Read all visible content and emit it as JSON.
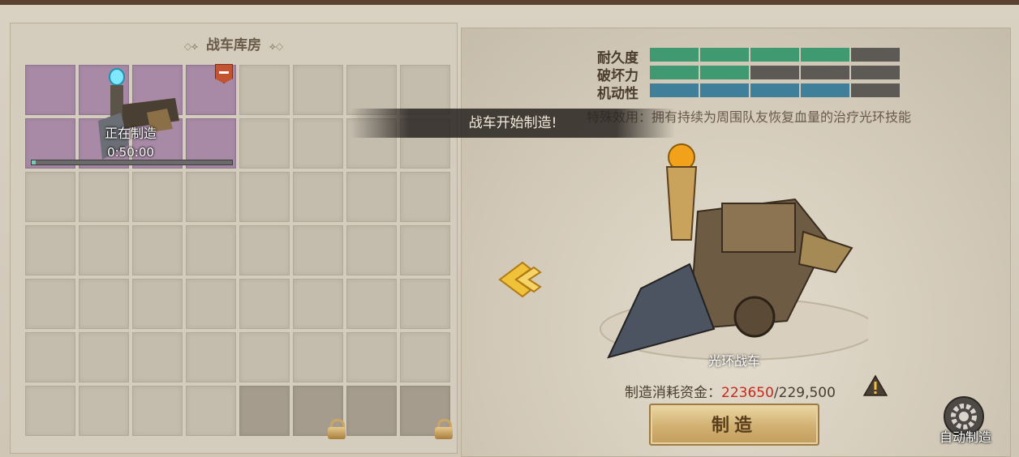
{
  "storage": {
    "title": "战车库房",
    "grid_rows": 7,
    "grid_cols": 8,
    "building": {
      "status": "正在制造",
      "time": "0:50:00",
      "progress": 0.02
    }
  },
  "details": {
    "stats": [
      {
        "label": "耐久度",
        "filled": 4,
        "total": 5,
        "color": "#3f9a72"
      },
      {
        "label": "破坏力",
        "filled": 2,
        "total": 5,
        "color": "#3f9a72"
      },
      {
        "label": "机动性",
        "filled": 4,
        "total": 5,
        "color": "#3f7f9a"
      }
    ],
    "effect": "特殊效用：拥有持续为周围队友恢复血量的治疗光环技能",
    "vehicle_name": "光环战车",
    "cost_label": "制造消耗资金：",
    "cost_current": "223650",
    "cost_total": "/229,500",
    "make_button": "制造",
    "auto_button": "自动制造"
  },
  "toast": "战车开始制造!",
  "icons": {
    "arrow": "arrow-left-icon",
    "warning": "warning-icon",
    "gear": "gear-icon",
    "lock": "lock-icon",
    "remove": "remove-icon"
  }
}
